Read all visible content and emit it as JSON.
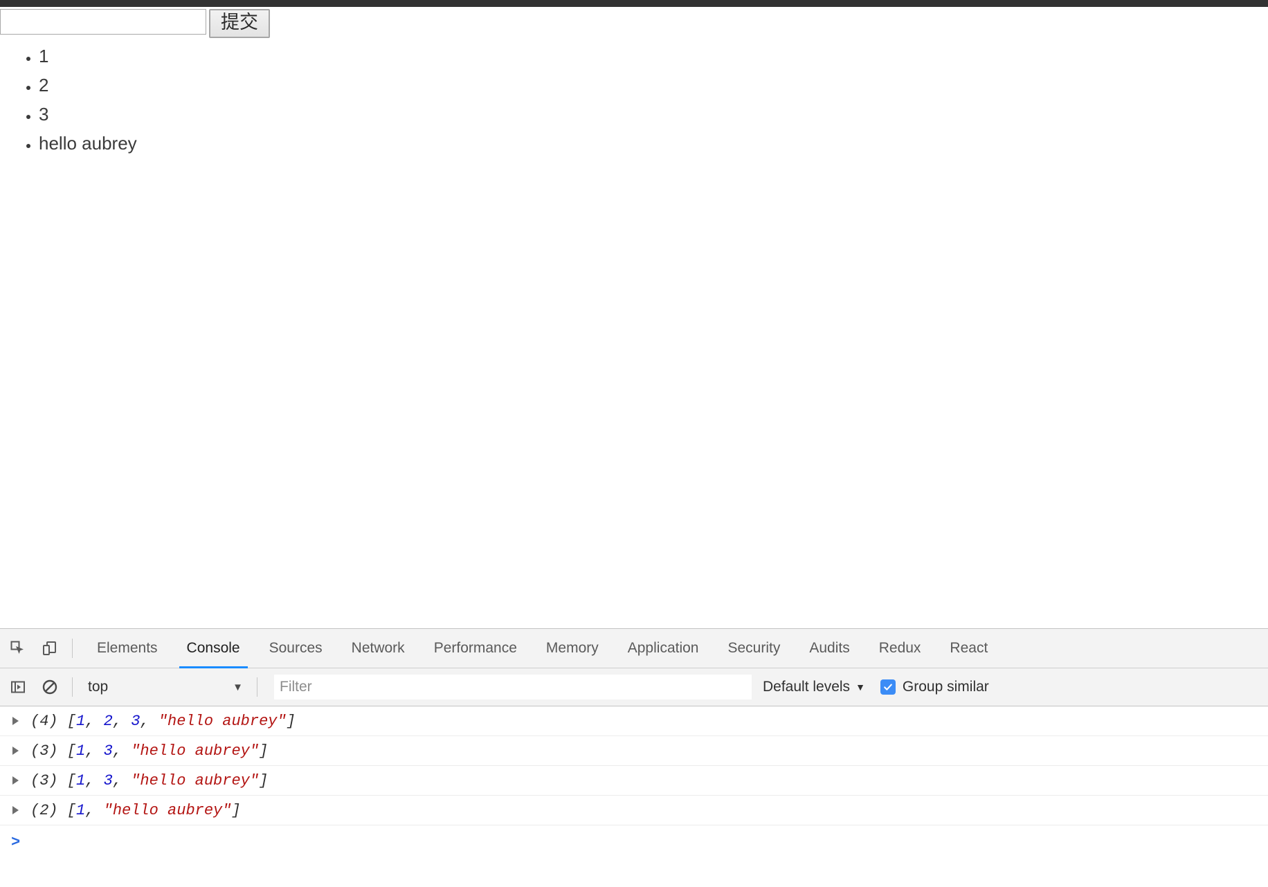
{
  "page": {
    "form": {
      "input_value": "",
      "input_placeholder": "",
      "submit_label": "提交"
    },
    "list_items": [
      "1",
      "2",
      "3",
      "hello aubrey"
    ]
  },
  "devtools": {
    "toolbar_icons": [
      {
        "name": "inspect-element-icon",
        "title": "Inspect element"
      },
      {
        "name": "device-toolbar-icon",
        "title": "Toggle device toolbar"
      }
    ],
    "tabs": [
      {
        "label": "Elements",
        "active": false
      },
      {
        "label": "Console",
        "active": true
      },
      {
        "label": "Sources",
        "active": false
      },
      {
        "label": "Network",
        "active": false
      },
      {
        "label": "Performance",
        "active": false
      },
      {
        "label": "Memory",
        "active": false
      },
      {
        "label": "Application",
        "active": false
      },
      {
        "label": "Security",
        "active": false
      },
      {
        "label": "Audits",
        "active": false
      },
      {
        "label": "Redux",
        "active": false
      },
      {
        "label": "React",
        "active": false
      }
    ],
    "filterbar": {
      "sidebar_toggle_icon": "show-console-sidebar-icon",
      "clear_console_icon": "clear-console-icon",
      "context_value": "top",
      "context_caret": "▼",
      "filter_value": "",
      "filter_placeholder": "Filter",
      "levels_label": "Default levels",
      "levels_caret": "▼",
      "group_similar_label": "Group similar",
      "group_similar_checked": true,
      "accent_color": "#3b8cf6"
    },
    "console_rows": [
      {
        "disclosure": "▶",
        "length": "(4)",
        "tokens": [
          {
            "t": "[",
            "k": "punc"
          },
          {
            "t": "1",
            "k": "num"
          },
          {
            "t": ", ",
            "k": "punc"
          },
          {
            "t": "2",
            "k": "num"
          },
          {
            "t": ", ",
            "k": "punc"
          },
          {
            "t": "3",
            "k": "num"
          },
          {
            "t": ", ",
            "k": "punc"
          },
          {
            "t": "\"hello aubrey\"",
            "k": "str"
          },
          {
            "t": "]",
            "k": "punc"
          }
        ]
      },
      {
        "disclosure": "▶",
        "length": "(3)",
        "tokens": [
          {
            "t": "[",
            "k": "punc"
          },
          {
            "t": "1",
            "k": "num"
          },
          {
            "t": ", ",
            "k": "punc"
          },
          {
            "t": "3",
            "k": "num"
          },
          {
            "t": ", ",
            "k": "punc"
          },
          {
            "t": "\"hello aubrey\"",
            "k": "str"
          },
          {
            "t": "]",
            "k": "punc"
          }
        ]
      },
      {
        "disclosure": "▶",
        "length": "(3)",
        "tokens": [
          {
            "t": "[",
            "k": "punc"
          },
          {
            "t": "1",
            "k": "num"
          },
          {
            "t": ", ",
            "k": "punc"
          },
          {
            "t": "3",
            "k": "num"
          },
          {
            "t": ", ",
            "k": "punc"
          },
          {
            "t": "\"hello aubrey\"",
            "k": "str"
          },
          {
            "t": "]",
            "k": "punc"
          }
        ]
      },
      {
        "disclosure": "▶",
        "length": "(2)",
        "tokens": [
          {
            "t": "[",
            "k": "punc"
          },
          {
            "t": "1",
            "k": "num"
          },
          {
            "t": ", ",
            "k": "punc"
          },
          {
            "t": "\"hello aubrey\"",
            "k": "str"
          },
          {
            "t": "]",
            "k": "punc"
          }
        ]
      }
    ],
    "prompt_symbol": ">"
  }
}
